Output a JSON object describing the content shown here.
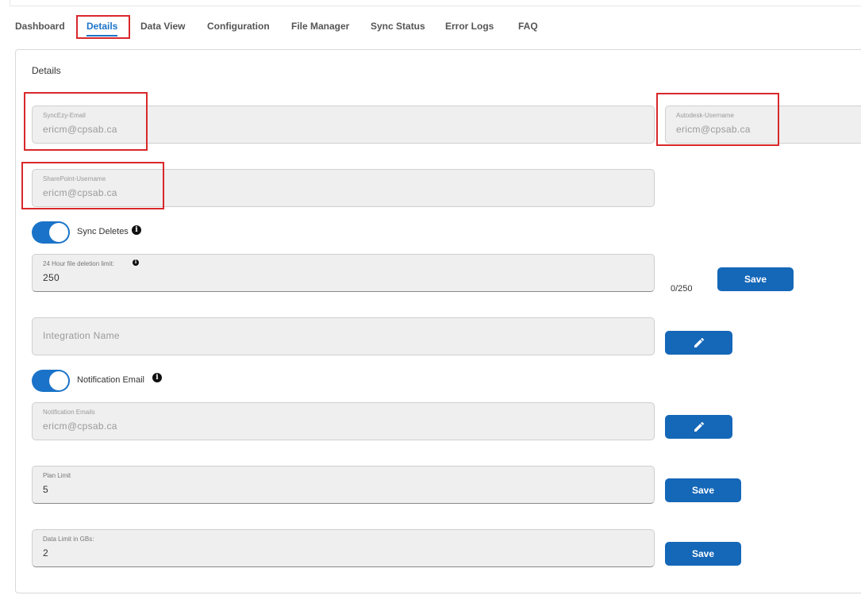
{
  "tabs": [
    {
      "label": "Dashboard"
    },
    {
      "label": "Details"
    },
    {
      "label": "Data View"
    },
    {
      "label": "Configuration"
    },
    {
      "label": "File Manager"
    },
    {
      "label": "Sync Status"
    },
    {
      "label": "Error Logs"
    },
    {
      "label": "FAQ"
    }
  ],
  "active_tab": "Details",
  "section_title": "Details",
  "fields": {
    "syncezy_email": {
      "label": "SyncEzy-Email",
      "value": "ericm@cpsab.ca"
    },
    "autodesk_username": {
      "label": "Autodesk-Username",
      "value": "ericm@cpsab.ca"
    },
    "sharepoint_username": {
      "label": "SharePoint-Username",
      "value": "ericm@cpsab.ca"
    },
    "deletion_limit": {
      "label": "24 Hour file deletion limit:",
      "value": "250",
      "counter": "0/250"
    },
    "integration_name": {
      "placeholder": "Integration Name"
    },
    "notification_emails": {
      "label": "Notification Emails",
      "value": "ericm@cpsab.ca"
    },
    "plan_limit": {
      "label": "Plan Limit",
      "value": "5"
    },
    "data_limit": {
      "label": "Data Limit in GBs:",
      "value": "2"
    }
  },
  "toggles": {
    "sync_deletes": {
      "label": "Sync Deletes",
      "on": true
    },
    "notification_email": {
      "label": "Notification Email",
      "on": true
    }
  },
  "buttons": {
    "save_label": "Save",
    "edit_icon": "pencil-icon"
  },
  "colors": {
    "accent": "#1a73c8",
    "button": "#1567b8",
    "highlight_box": "#d9282b",
    "field_bg": "#efefef"
  }
}
